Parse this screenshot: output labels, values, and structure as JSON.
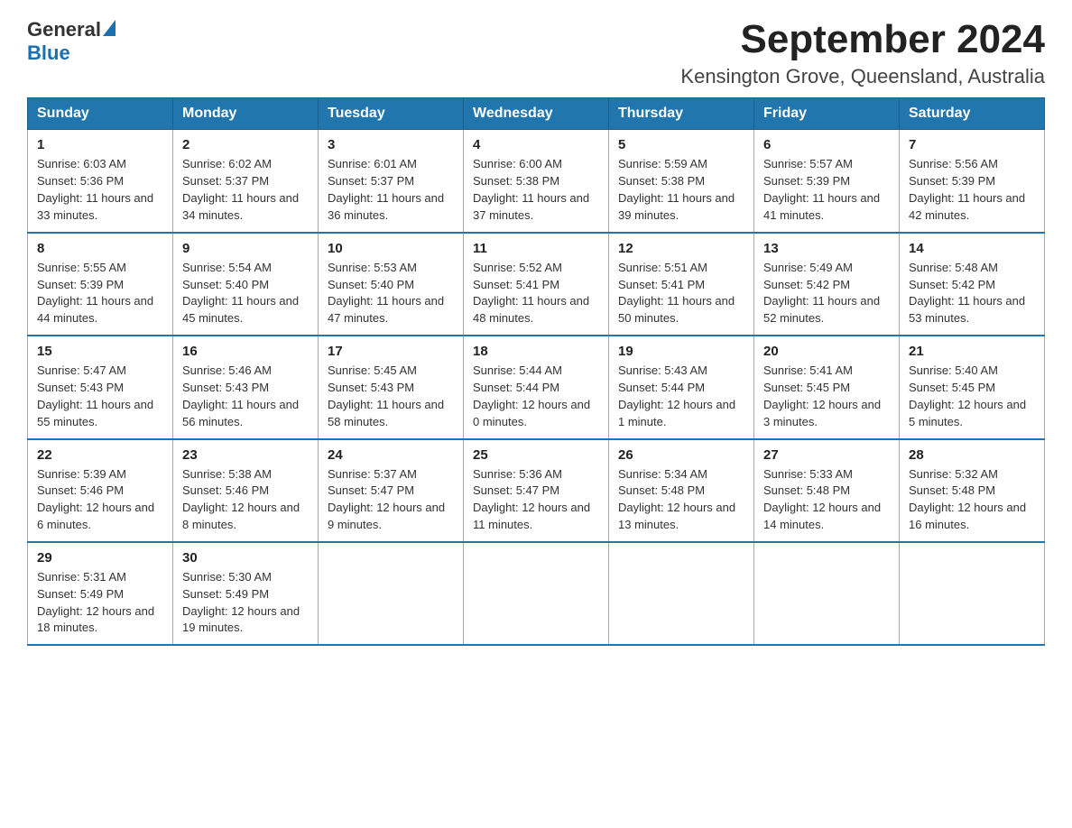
{
  "logo": {
    "general": "General",
    "blue": "Blue"
  },
  "title": "September 2024",
  "subtitle": "Kensington Grove, Queensland, Australia",
  "weekdays": [
    "Sunday",
    "Monday",
    "Tuesday",
    "Wednesday",
    "Thursday",
    "Friday",
    "Saturday"
  ],
  "weeks": [
    [
      {
        "day": "1",
        "sunrise": "6:03 AM",
        "sunset": "5:36 PM",
        "daylight": "11 hours and 33 minutes."
      },
      {
        "day": "2",
        "sunrise": "6:02 AM",
        "sunset": "5:37 PM",
        "daylight": "11 hours and 34 minutes."
      },
      {
        "day": "3",
        "sunrise": "6:01 AM",
        "sunset": "5:37 PM",
        "daylight": "11 hours and 36 minutes."
      },
      {
        "day": "4",
        "sunrise": "6:00 AM",
        "sunset": "5:38 PM",
        "daylight": "11 hours and 37 minutes."
      },
      {
        "day": "5",
        "sunrise": "5:59 AM",
        "sunset": "5:38 PM",
        "daylight": "11 hours and 39 minutes."
      },
      {
        "day": "6",
        "sunrise": "5:57 AM",
        "sunset": "5:39 PM",
        "daylight": "11 hours and 41 minutes."
      },
      {
        "day": "7",
        "sunrise": "5:56 AM",
        "sunset": "5:39 PM",
        "daylight": "11 hours and 42 minutes."
      }
    ],
    [
      {
        "day": "8",
        "sunrise": "5:55 AM",
        "sunset": "5:39 PM",
        "daylight": "11 hours and 44 minutes."
      },
      {
        "day": "9",
        "sunrise": "5:54 AM",
        "sunset": "5:40 PM",
        "daylight": "11 hours and 45 minutes."
      },
      {
        "day": "10",
        "sunrise": "5:53 AM",
        "sunset": "5:40 PM",
        "daylight": "11 hours and 47 minutes."
      },
      {
        "day": "11",
        "sunrise": "5:52 AM",
        "sunset": "5:41 PM",
        "daylight": "11 hours and 48 minutes."
      },
      {
        "day": "12",
        "sunrise": "5:51 AM",
        "sunset": "5:41 PM",
        "daylight": "11 hours and 50 minutes."
      },
      {
        "day": "13",
        "sunrise": "5:49 AM",
        "sunset": "5:42 PM",
        "daylight": "11 hours and 52 minutes."
      },
      {
        "day": "14",
        "sunrise": "5:48 AM",
        "sunset": "5:42 PM",
        "daylight": "11 hours and 53 minutes."
      }
    ],
    [
      {
        "day": "15",
        "sunrise": "5:47 AM",
        "sunset": "5:43 PM",
        "daylight": "11 hours and 55 minutes."
      },
      {
        "day": "16",
        "sunrise": "5:46 AM",
        "sunset": "5:43 PM",
        "daylight": "11 hours and 56 minutes."
      },
      {
        "day": "17",
        "sunrise": "5:45 AM",
        "sunset": "5:43 PM",
        "daylight": "11 hours and 58 minutes."
      },
      {
        "day": "18",
        "sunrise": "5:44 AM",
        "sunset": "5:44 PM",
        "daylight": "12 hours and 0 minutes."
      },
      {
        "day": "19",
        "sunrise": "5:43 AM",
        "sunset": "5:44 PM",
        "daylight": "12 hours and 1 minute."
      },
      {
        "day": "20",
        "sunrise": "5:41 AM",
        "sunset": "5:45 PM",
        "daylight": "12 hours and 3 minutes."
      },
      {
        "day": "21",
        "sunrise": "5:40 AM",
        "sunset": "5:45 PM",
        "daylight": "12 hours and 5 minutes."
      }
    ],
    [
      {
        "day": "22",
        "sunrise": "5:39 AM",
        "sunset": "5:46 PM",
        "daylight": "12 hours and 6 minutes."
      },
      {
        "day": "23",
        "sunrise": "5:38 AM",
        "sunset": "5:46 PM",
        "daylight": "12 hours and 8 minutes."
      },
      {
        "day": "24",
        "sunrise": "5:37 AM",
        "sunset": "5:47 PM",
        "daylight": "12 hours and 9 minutes."
      },
      {
        "day": "25",
        "sunrise": "5:36 AM",
        "sunset": "5:47 PM",
        "daylight": "12 hours and 11 minutes."
      },
      {
        "day": "26",
        "sunrise": "5:34 AM",
        "sunset": "5:48 PM",
        "daylight": "12 hours and 13 minutes."
      },
      {
        "day": "27",
        "sunrise": "5:33 AM",
        "sunset": "5:48 PM",
        "daylight": "12 hours and 14 minutes."
      },
      {
        "day": "28",
        "sunrise": "5:32 AM",
        "sunset": "5:48 PM",
        "daylight": "12 hours and 16 minutes."
      }
    ],
    [
      {
        "day": "29",
        "sunrise": "5:31 AM",
        "sunset": "5:49 PM",
        "daylight": "12 hours and 18 minutes."
      },
      {
        "day": "30",
        "sunrise": "5:30 AM",
        "sunset": "5:49 PM",
        "daylight": "12 hours and 19 minutes."
      },
      null,
      null,
      null,
      null,
      null
    ]
  ]
}
